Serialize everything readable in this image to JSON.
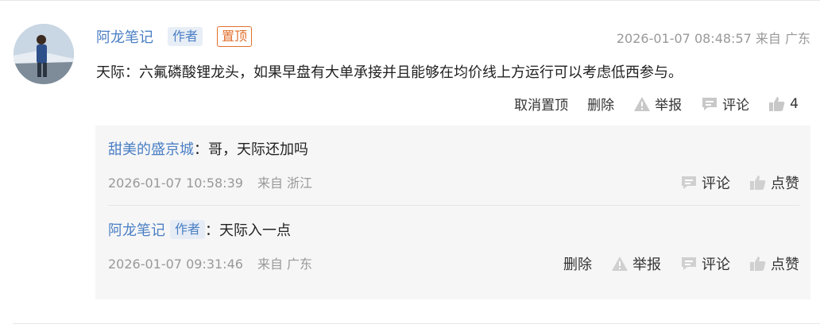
{
  "post": {
    "author": "阿龙笔记",
    "author_badge": "作者",
    "pin_badge": "置顶",
    "timestamp": "2026-01-07 08:48:57",
    "location": "来自 广东",
    "content": "天际：六氟磷酸锂龙头，如果早盘有大单承接并且能够在均价线上方运行可以考虑低西参与。",
    "actions": {
      "unpin": "取消置顶",
      "delete": "删除",
      "report": "举报",
      "comment": "评论",
      "like_count": "4"
    }
  },
  "replies": [
    {
      "user": "甜美的盛京城",
      "text": "：哥，天际还加吗",
      "timestamp": "2026-01-07 10:58:39",
      "location": "来自 浙江",
      "actions": {
        "comment": "评论",
        "like": "点赞"
      }
    },
    {
      "user": "阿龙笔记",
      "badge": "作者",
      "text": "：天际入一点",
      "timestamp": "2026-01-07 09:31:46",
      "location": "来自 广东",
      "actions": {
        "delete": "删除",
        "report": "举报",
        "comment": "评论",
        "like": "点赞"
      }
    }
  ],
  "colors": {
    "link": "#4a7fc4",
    "pin": "#e26f2c",
    "muted": "#999999",
    "icon": "#cccccc"
  },
  "icons": [
    "warning-icon",
    "comment-icon",
    "thumbs-up-icon"
  ]
}
